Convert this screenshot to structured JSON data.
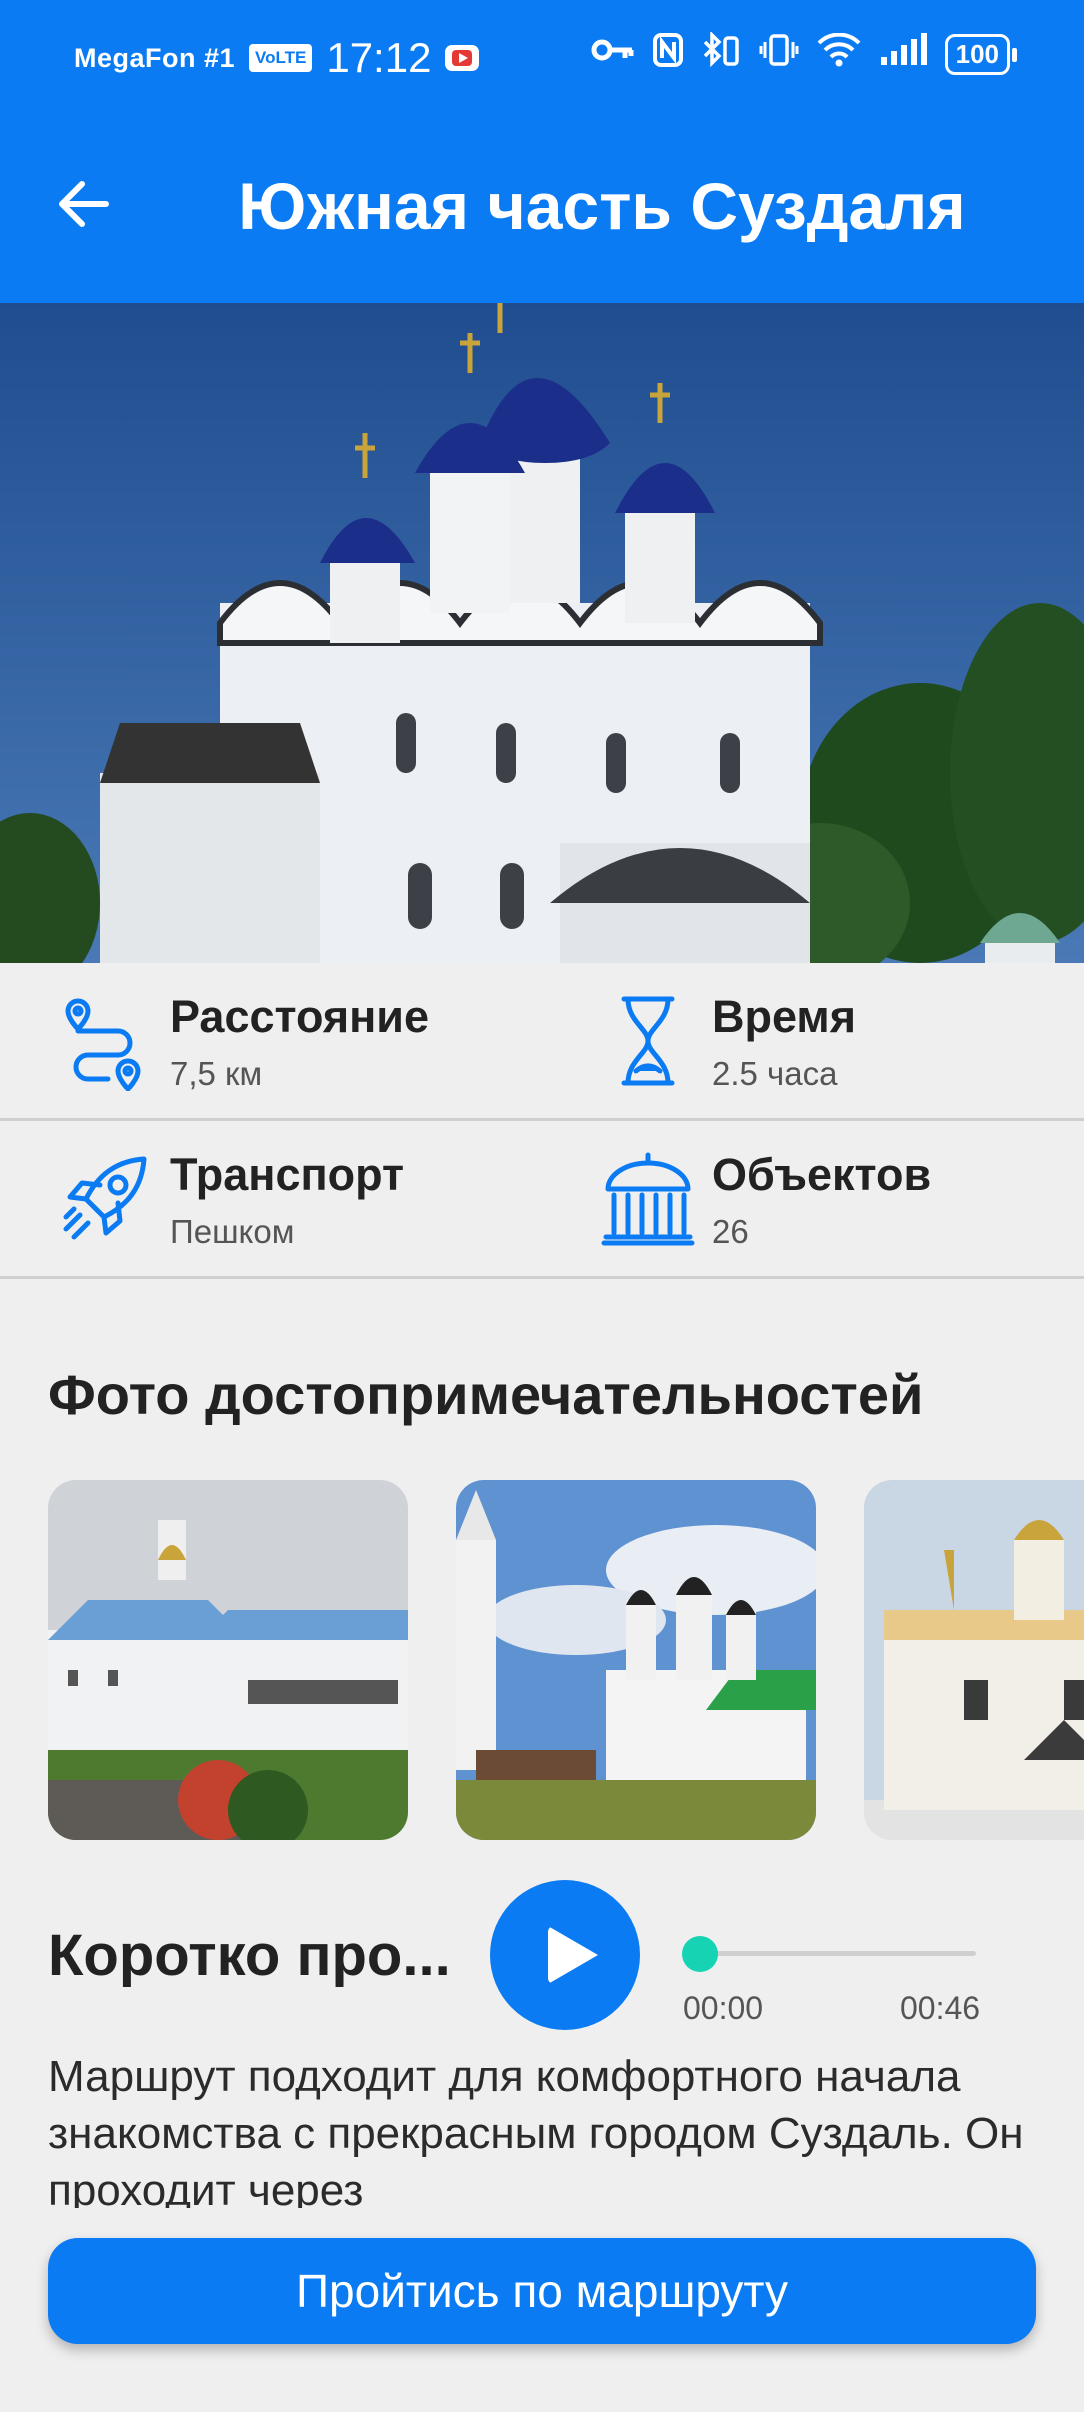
{
  "status_bar": {
    "carrier": "MegaFon #1",
    "volte": "VoLTE",
    "time": "17:12",
    "battery": "100"
  },
  "header": {
    "title": "Южная часть Суздаля",
    "back_icon": "arrow-left-icon"
  },
  "stats": [
    {
      "icon": "route-icon",
      "label": "Расстояние",
      "value": "7,5 км"
    },
    {
      "icon": "hourglass-icon",
      "label": "Время",
      "value": "2.5 часа"
    },
    {
      "icon": "rocket-icon",
      "label": "Транспорт",
      "value": "Пешком"
    },
    {
      "icon": "museum-icon",
      "label": "Объектов",
      "value": "26"
    }
  ],
  "photos_section": {
    "title": "Фото достопримечательностей"
  },
  "audio": {
    "title": "Коротко про...",
    "current": "00:00",
    "duration": "00:46",
    "progress": 0
  },
  "description": "Маршрут подходит для комфортного начала знакомства с прекрасным городом Суздаль. Он проходит через",
  "cta": {
    "label": "Пройтись по маршруту"
  },
  "colors": {
    "primary": "#0a7bf3",
    "accent": "#16d3b3",
    "background": "#efefef"
  }
}
